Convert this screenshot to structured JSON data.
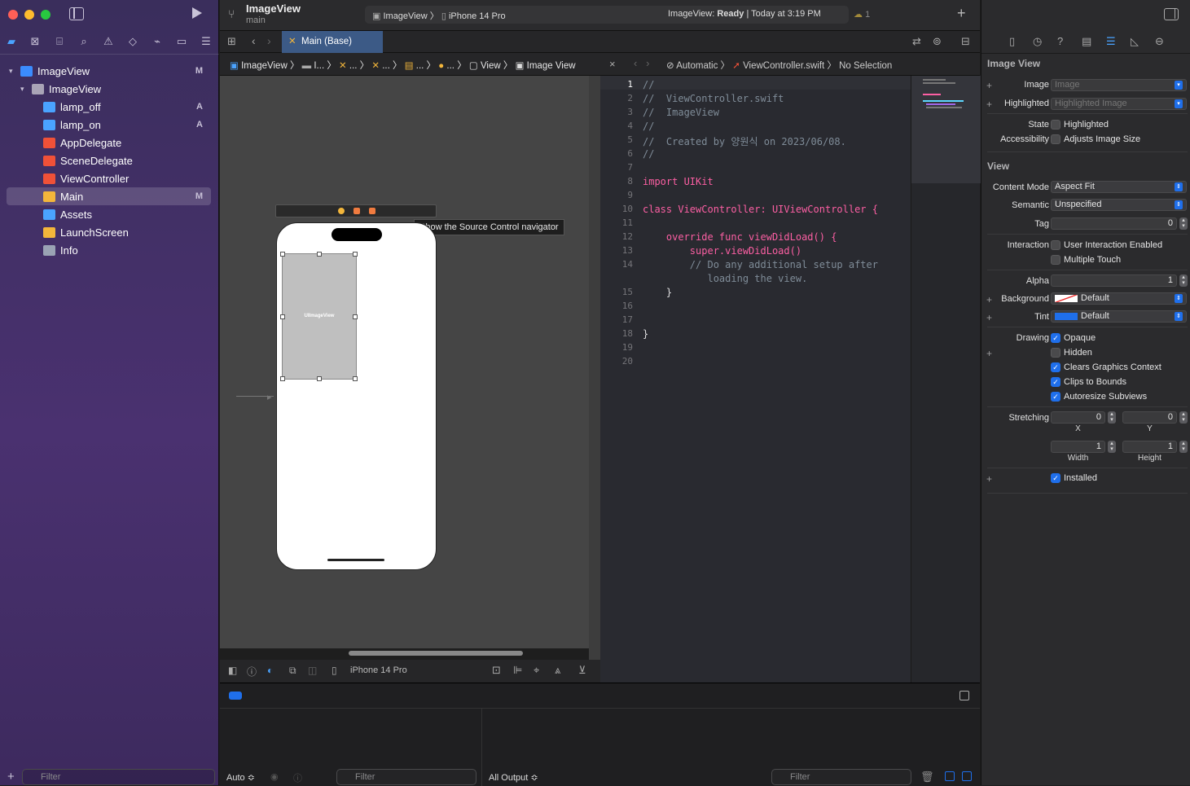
{
  "window": {
    "project": "ImageView",
    "branch": "main",
    "scheme": "ImageView",
    "device": "iPhone 14 Pro",
    "status_prefix": "ImageView:",
    "status_state": "Ready",
    "status_time": "| Today at 3:19 PM",
    "warnings_count": "1"
  },
  "navigator": {
    "items": [
      {
        "label": "ImageView",
        "badge": "M"
      },
      {
        "label": "ImageView",
        "badge": ""
      },
      {
        "label": "lamp_off",
        "badge": "A"
      },
      {
        "label": "lamp_on",
        "badge": "A"
      },
      {
        "label": "AppDelegate",
        "badge": ""
      },
      {
        "label": "SceneDelegate",
        "badge": ""
      },
      {
        "label": "ViewController",
        "badge": ""
      },
      {
        "label": "Main",
        "badge": "M"
      },
      {
        "label": "Assets",
        "badge": ""
      },
      {
        "label": "LaunchScreen",
        "badge": ""
      },
      {
        "label": "Info",
        "badge": ""
      }
    ],
    "filter_placeholder": "Filter"
  },
  "tabs": {
    "active": "Main (Base)"
  },
  "jumpbar_left": {
    "c1": "ImageView",
    "c2": "I...",
    "c3": "...",
    "c4": "...",
    "c5": "...",
    "c6": "...",
    "c7": "View",
    "c8": "Image View"
  },
  "jumpbar_right": {
    "mode": "Automatic",
    "file": "ViewController.swift",
    "selection": "No Selection"
  },
  "canvas": {
    "tooltip": "Show the Source Control navigator",
    "imageview_label": "UIImageView",
    "bottom_device": "iPhone 14 Pro"
  },
  "code": {
    "line_numbers": [
      "1",
      "2",
      "3",
      "4",
      "5",
      "6",
      "7",
      "8",
      "9",
      "10",
      "11",
      "12",
      "13",
      "14",
      "",
      "15",
      "16",
      "17",
      "18",
      "19",
      "20"
    ],
    "lines": [
      "//",
      "//  ViewController.swift",
      "//  ImageView",
      "//",
      "//  Created by 양원식 on 2023/06/08.",
      "//",
      "",
      "import UIKit",
      "",
      "class ViewController: UIViewController {",
      "",
      "    override func viewDidLoad() {",
      "        super.viewDidLoad()",
      "        // Do any additional setup after",
      "           loading the view.",
      "    }",
      "",
      "",
      "}",
      "",
      ""
    ]
  },
  "debug": {
    "auto_label": "Auto ≎",
    "filter_placeholder": "Filter",
    "output_label": "All Output ≎",
    "filter2_placeholder": "Filter"
  },
  "inspector": {
    "image_view_title": "Image View",
    "image_label": "Image",
    "image_placeholder": "Image",
    "highlighted_label": "Highlighted",
    "highlighted_placeholder": "Highlighted Image",
    "state_label": "State",
    "state_option": "Highlighted",
    "accessibility_label": "Accessibility",
    "accessibility_option": "Adjusts Image Size",
    "view_title": "View",
    "content_mode_label": "Content Mode",
    "content_mode_value": "Aspect Fit",
    "semantic_label": "Semantic",
    "semantic_value": "Unspecified",
    "tag_label": "Tag",
    "tag_value": "0",
    "interaction_label": "Interaction",
    "interaction_opt1": "User Interaction Enabled",
    "interaction_opt2": "Multiple Touch",
    "alpha_label": "Alpha",
    "alpha_value": "1",
    "background_label": "Background",
    "background_value": "Default",
    "tint_label": "Tint",
    "tint_value": "Default",
    "drawing_label": "Drawing",
    "drawing_opaque": "Opaque",
    "drawing_hidden": "Hidden",
    "drawing_clears": "Clears Graphics Context",
    "drawing_clips": "Clips to Bounds",
    "drawing_autoresize": "Autoresize Subviews",
    "stretching_label": "Stretching",
    "stretch_x": "0",
    "stretch_y": "0",
    "stretch_x_label": "X",
    "stretch_y_label": "Y",
    "stretch_w": "1",
    "stretch_h": "1",
    "stretch_w_label": "Width",
    "stretch_h_label": "Height",
    "installed_label": "Installed"
  },
  "colors": {
    "accent": "#1f6feb",
    "sidebar": "#4a3170"
  }
}
